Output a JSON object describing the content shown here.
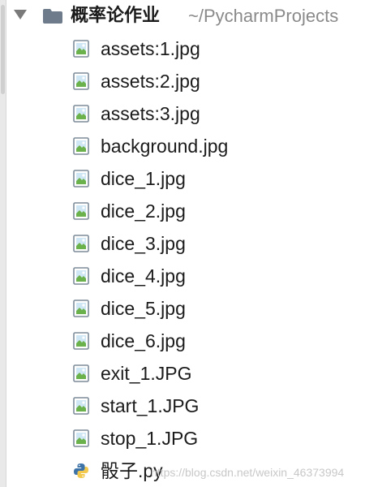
{
  "project": {
    "root_folder_name": "概率论作业",
    "root_folder_path": "~/PycharmProjects",
    "expanded": true
  },
  "files": [
    {
      "name": "assets:1.jpg",
      "icon": "image-file-icon"
    },
    {
      "name": "assets:2.jpg",
      "icon": "image-file-icon"
    },
    {
      "name": "assets:3.jpg",
      "icon": "image-file-icon"
    },
    {
      "name": "background.jpg",
      "icon": "image-file-icon"
    },
    {
      "name": "dice_1.jpg",
      "icon": "image-file-icon"
    },
    {
      "name": "dice_2.jpg",
      "icon": "image-file-icon"
    },
    {
      "name": "dice_3.jpg",
      "icon": "image-file-icon"
    },
    {
      "name": "dice_4.jpg",
      "icon": "image-file-icon"
    },
    {
      "name": "dice_5.jpg",
      "icon": "image-file-icon"
    },
    {
      "name": "dice_6.jpg",
      "icon": "image-file-icon"
    },
    {
      "name": "exit_1.JPG",
      "icon": "image-file-icon"
    },
    {
      "name": "start_1.JPG",
      "icon": "image-file-icon"
    },
    {
      "name": "stop_1.JPG",
      "icon": "image-file-icon"
    },
    {
      "name": "骰子.py",
      "icon": "python-file-icon"
    }
  ],
  "watermark": "https://blog.csdn.net/weixin_46373994",
  "colors": {
    "text": "#1b1b1b",
    "path_text": "#8a8a8a",
    "chevron": "#7a7a7a",
    "folder": "#6e7b8b",
    "image_icon_frame": "#7d8c99",
    "image_icon_sky": "#cfe6f5",
    "image_icon_hill": "#6cb24c",
    "python_blue": "#3e73a8",
    "python_yellow": "#f2c94c"
  }
}
